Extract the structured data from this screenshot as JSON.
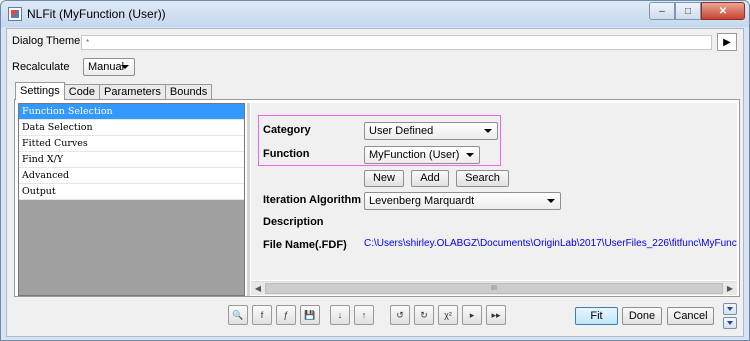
{
  "window": {
    "title": "NLFit (MyFunction (User))"
  },
  "titlebar_buttons": {
    "minimize": "–",
    "maximize": "□",
    "close": "✕"
  },
  "dialog_theme": {
    "label": "Dialog Theme",
    "value": "*",
    "arrow": "▶"
  },
  "recalculate": {
    "label": "Recalculate",
    "value": "Manual"
  },
  "tabs": [
    "Settings",
    "Code",
    "Parameters",
    "Bounds"
  ],
  "tree": {
    "items": [
      "Function Selection",
      "Data Selection",
      "Fitted Curves",
      "Find X/Y",
      "Advanced",
      "Output"
    ],
    "selected_index": 0
  },
  "settings": {
    "category_label": "Category",
    "category_value": "User Defined",
    "function_label": "Function",
    "function_value": "MyFunction (User)",
    "new_button": "New",
    "add_button": "Add",
    "search_button": "Search",
    "iteration_label": "Iteration Algorithm",
    "iteration_value": "Levenberg Marquardt",
    "description_label": "Description",
    "filename_label": "File Name(.FDF)",
    "filename_value": "C:\\Users\\shirley.OLABGZ\\Documents\\OriginLab\\2017\\UserFiles_226\\fitfunc\\MyFunction.FDF"
  },
  "scrollbar": {
    "left_arrow": "◀",
    "right_arrow": "▶",
    "grip": "III"
  },
  "toolbar_icons": [
    "fit-preview-icon",
    "fit-parameter-icon",
    "fdf-file-icon",
    "save-icon",
    "sort-ascending-icon",
    "sort-descending-icon",
    "undo-fit-icon",
    "redo-fit-icon",
    "chi-square-icon",
    "one-iteration-icon",
    "fit-till-converge-icon"
  ],
  "toolbar_glyphs": [
    "🔍",
    "f",
    "ƒ",
    "💾",
    "↓",
    "↑",
    "↺",
    "↻",
    "χ²",
    "▸",
    "▸▸"
  ],
  "bottom_buttons": {
    "fit": "Fit",
    "done": "Done",
    "cancel": "Cancel"
  },
  "colors": {
    "highlight_box": "#f066e6",
    "selection": "#3399ff",
    "link_path": "#0000ee"
  }
}
